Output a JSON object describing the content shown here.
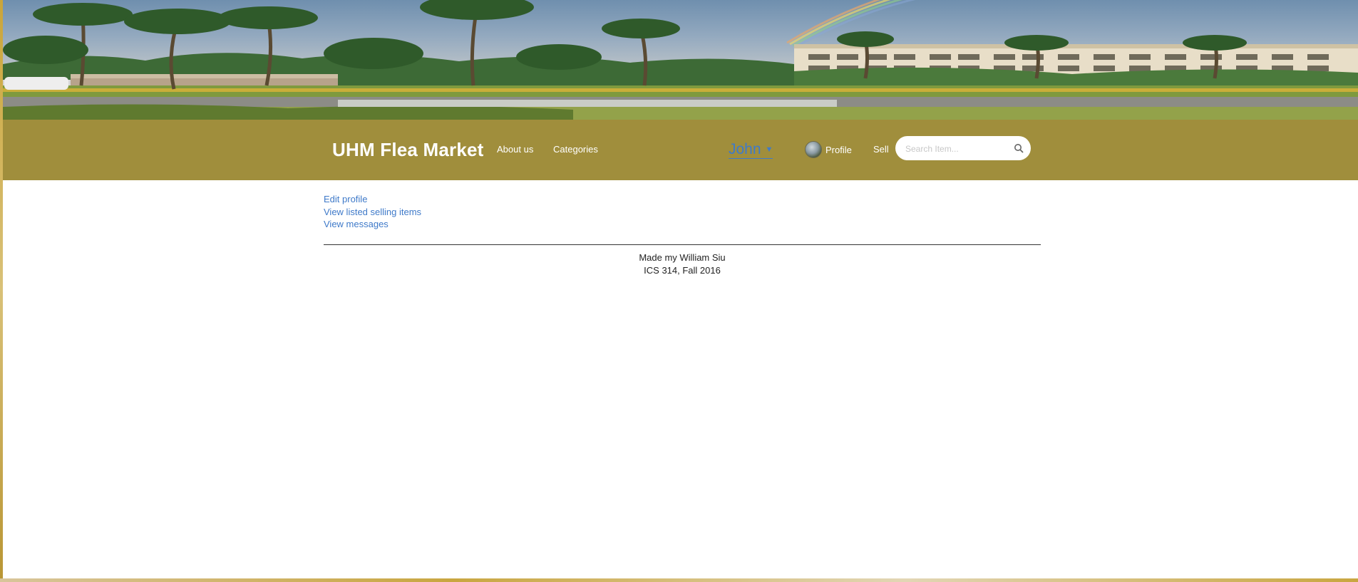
{
  "navbar": {
    "brand": "UHM Flea Market",
    "about": "About us",
    "categories": "Categories",
    "user": "John",
    "user_caret": "▼",
    "profile": "Profile",
    "sell": "Sell",
    "search_placeholder": "Search Item..."
  },
  "profile_menu": {
    "edit_profile": "Edit profile",
    "view_items": "View listed selling items",
    "view_messages": "View messages"
  },
  "footer": {
    "line1": "Made my William Siu",
    "line2": "ICS 314, Fall 2016"
  },
  "colors": {
    "navbar_bg": "#a08e3c",
    "link": "#3f7ac9",
    "page_bg": "#ffffff"
  },
  "icons": {
    "search": "search-icon",
    "avatar": "avatar",
    "dropdown": "caret-down-icon"
  }
}
